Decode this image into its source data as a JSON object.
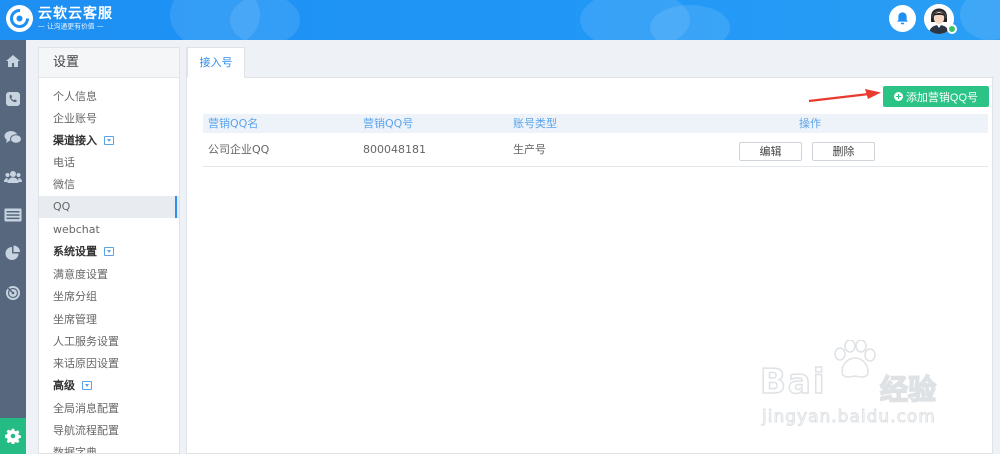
{
  "header": {
    "app_title": "云软云客服",
    "app_slogan": "— 让沟通更有价值 —",
    "bell_icon": "bell-icon",
    "avatar_icon": "user-avatar",
    "status_color": "#3cc36a"
  },
  "rail": {
    "items": [
      {
        "icon": "home-icon"
      },
      {
        "icon": "phone-icon"
      },
      {
        "icon": "chat-icon"
      },
      {
        "icon": "users-icon"
      },
      {
        "icon": "list-icon"
      },
      {
        "icon": "pie-chart-icon"
      },
      {
        "icon": "radar-icon"
      },
      {
        "icon": "gear-icon"
      }
    ],
    "active_color": "#25bb84"
  },
  "settings": {
    "title": "设置",
    "menu": [
      {
        "label": "个人信息",
        "type": "item"
      },
      {
        "label": "企业账号",
        "type": "item"
      },
      {
        "label": "渠道接入",
        "type": "group"
      },
      {
        "label": "电话",
        "type": "item"
      },
      {
        "label": "微信",
        "type": "item"
      },
      {
        "label": "QQ",
        "type": "item",
        "active": true
      },
      {
        "label": "webchat",
        "type": "item"
      },
      {
        "label": "系统设置",
        "type": "group"
      },
      {
        "label": "满意度设置",
        "type": "item"
      },
      {
        "label": "坐席分组",
        "type": "item"
      },
      {
        "label": "坐席管理",
        "type": "item"
      },
      {
        "label": "人工服务设置",
        "type": "item"
      },
      {
        "label": "来话原因设置",
        "type": "item"
      },
      {
        "label": "高级",
        "type": "group"
      },
      {
        "label": "全局消息配置",
        "type": "item"
      },
      {
        "label": "导航流程配置",
        "type": "item"
      },
      {
        "label": "数据字典",
        "type": "item"
      }
    ]
  },
  "main": {
    "tab_label": "接入号",
    "add_button_label": "添加营销QQ号",
    "table": {
      "headers": [
        "营销QQ名",
        "营销QQ号",
        "账号类型",
        "操作"
      ],
      "rows": [
        {
          "name": "公司企业QQ",
          "number": "800048181",
          "type": "生产号",
          "edit_label": "编辑",
          "delete_label": "删除"
        }
      ]
    },
    "accent_color": "#2e8def",
    "add_button_color": "#2cc387"
  },
  "watermark": {
    "brand": "Bai",
    "brand_tail": "经验",
    "url": "jingyan.baidu.com"
  }
}
